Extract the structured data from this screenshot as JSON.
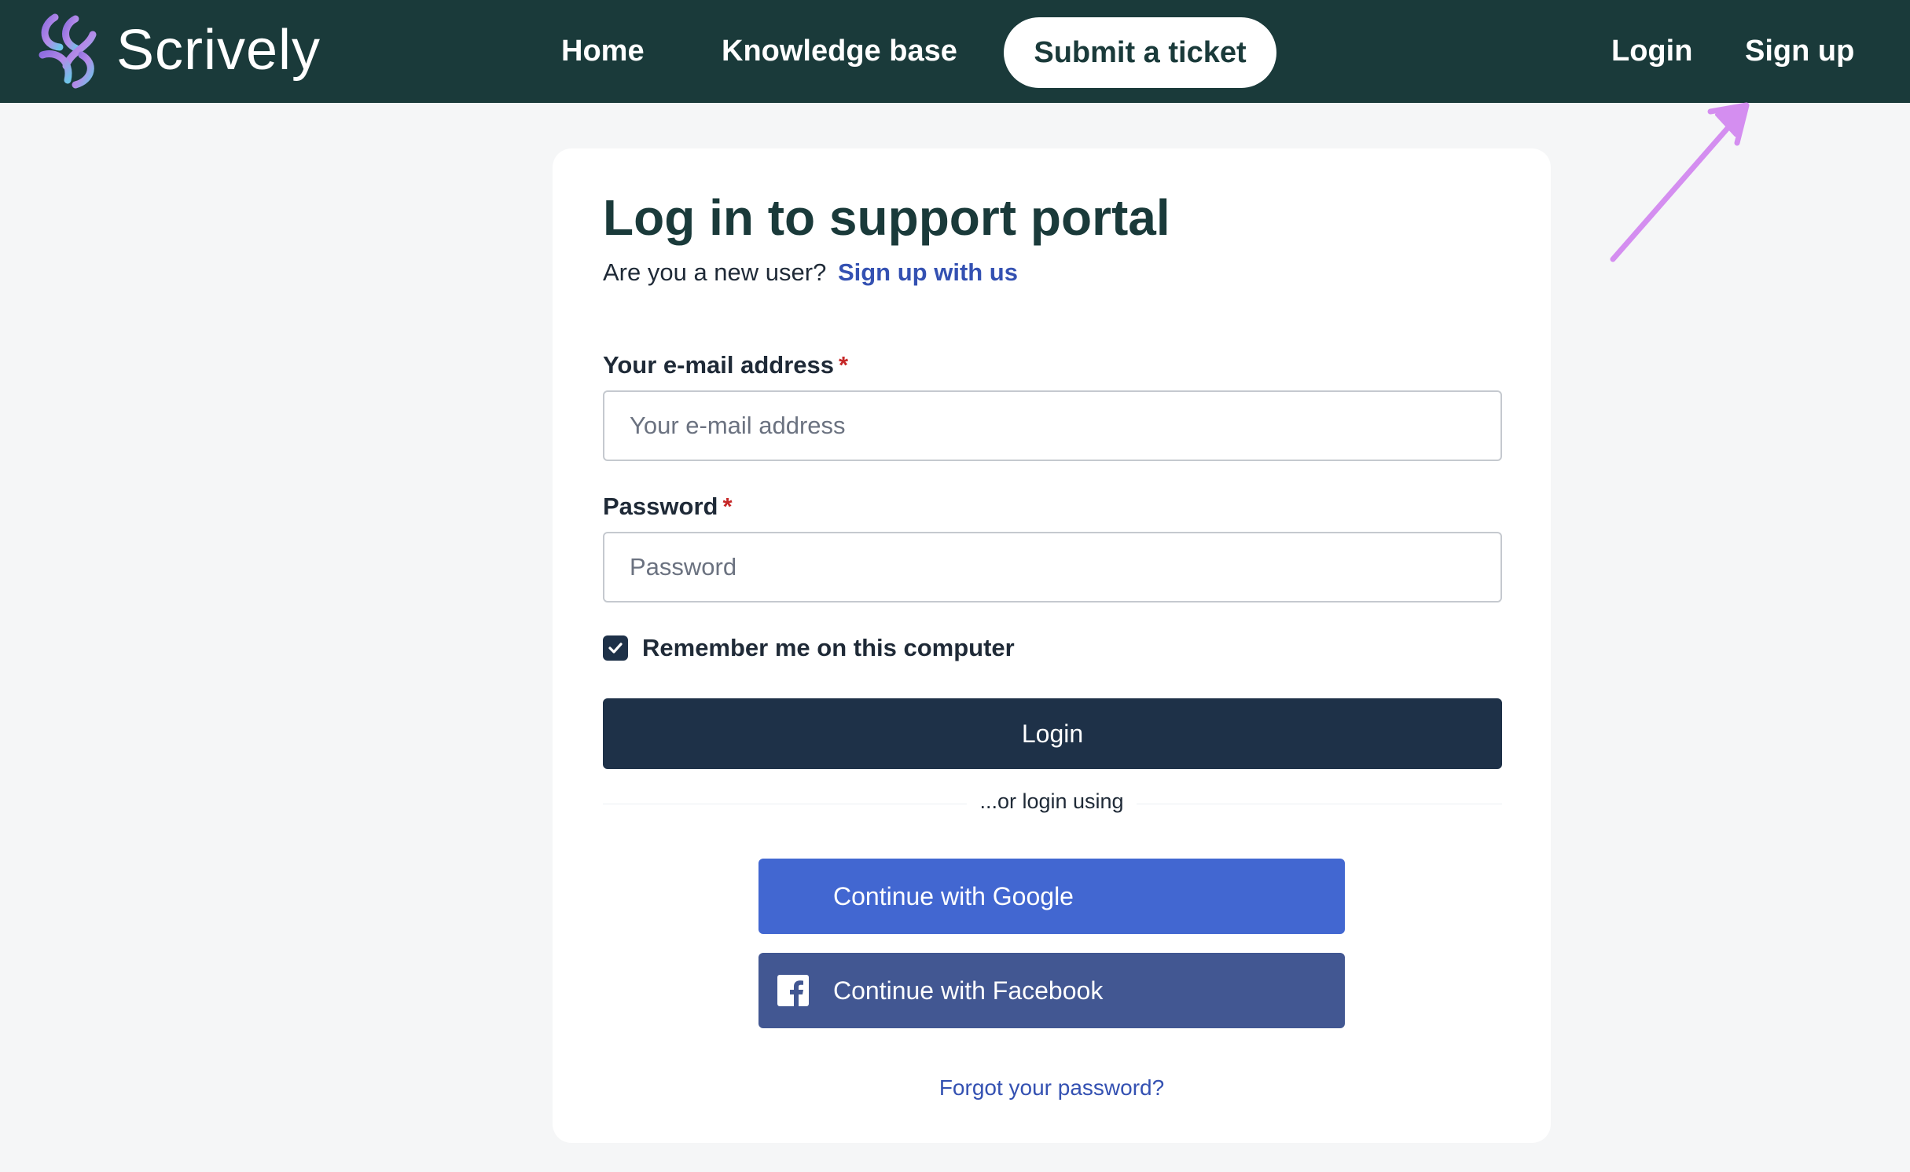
{
  "brand": {
    "name": "Scrively",
    "logo_icon": "swirl-logo-icon"
  },
  "nav": {
    "home": "Home",
    "knowledge_base": "Knowledge base",
    "submit_ticket": "Submit a ticket",
    "login": "Login",
    "sign_up": "Sign up"
  },
  "annotation": {
    "icon": "arrow-annotation-icon",
    "color": "#d48ef0"
  },
  "form": {
    "title": "Log in to support portal",
    "new_user_prompt": "Are you a new user?",
    "signup_link": "Sign up with us",
    "email_label": "Your e-mail address",
    "email_placeholder": "Your e-mail address",
    "password_label": "Password",
    "password_placeholder": "Password",
    "required_mark": "*",
    "remember_label": "Remember me on this computer",
    "remember_checked": true,
    "login_button": "Login",
    "or_text": "...or login using",
    "google_button": "Continue with Google",
    "facebook_button": "Continue with Facebook",
    "forgot_password": "Forgot your password?"
  },
  "colors": {
    "header_bg": "#1a3a3a",
    "primary_button": "#1e3148",
    "google_button": "#4267d1",
    "facebook_button": "#425792",
    "link": "#3451b2",
    "required": "#c62828"
  }
}
